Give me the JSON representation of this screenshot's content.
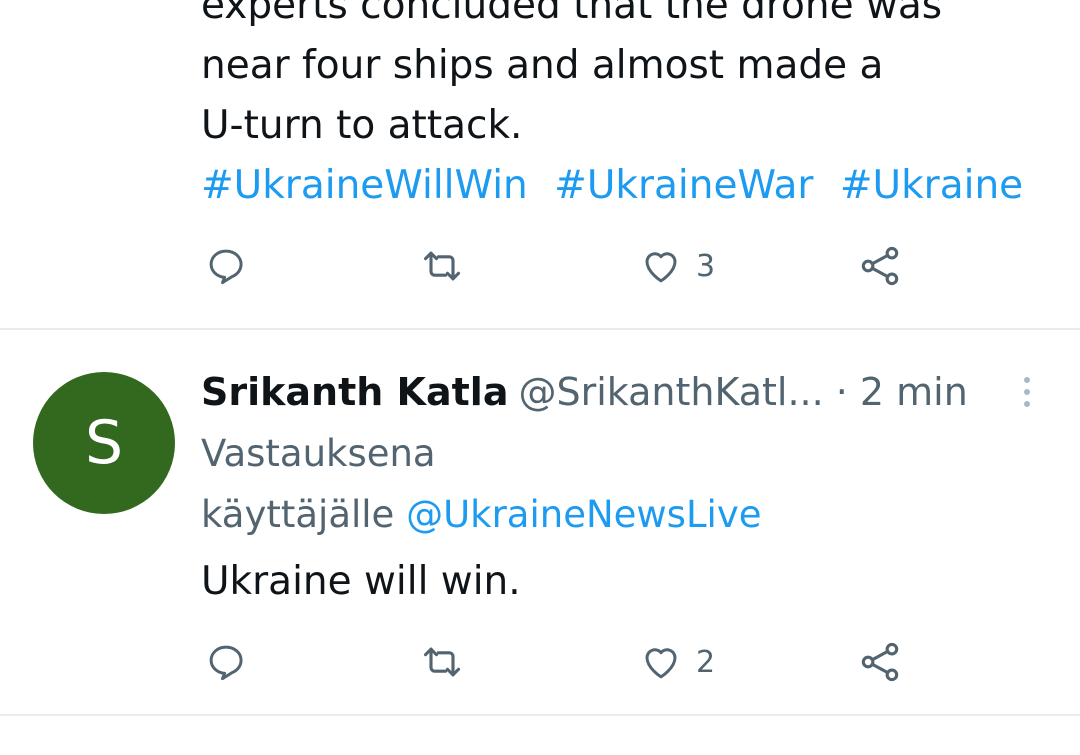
{
  "tweet1": {
    "text_lines": [
      "experts concluded that the drone was",
      "near four ships and almost made a",
      "U-turn to attack."
    ],
    "hashtags": [
      "#UkraineWillWin",
      "#UkraineWar",
      "#Ukraine"
    ],
    "like_count": "3"
  },
  "tweet2": {
    "avatar_letter": "S",
    "avatar_color": "#33691e",
    "display_name": "Srikanth Katla",
    "handle": "@SrikanthKatl...",
    "time": "· 2 min",
    "reply_prefix_line1": "Vastauksena",
    "reply_prefix_line2": "käyttäjälle",
    "reply_mention": "@UkraineNewsLive",
    "text": "Ukraine will win.",
    "like_count": "2"
  },
  "icons": {
    "reply": "reply-icon",
    "retweet": "retweet-icon",
    "like": "heart-icon",
    "share": "share-icon",
    "more": "more-vertical-icon"
  },
  "colors": {
    "link": "#1d9bf0",
    "secondary_text": "#536471",
    "divider": "#e6ecf0"
  }
}
